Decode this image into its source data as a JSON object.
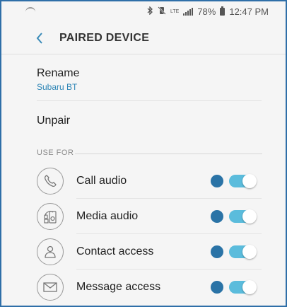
{
  "status_bar": {
    "bluetooth_icon": "bluetooth-icon",
    "mute_icon": "vibrate-mute-icon",
    "network": "LTE",
    "battery_percent": "78%",
    "time": "12:47 PM"
  },
  "header": {
    "back_icon": "chevron-left-icon",
    "title": "PAIRED DEVICE"
  },
  "rename": {
    "label": "Rename",
    "device_name": "Subaru BT"
  },
  "unpair": {
    "label": "Unpair"
  },
  "use_for": {
    "section_title": "USE FOR",
    "items": [
      {
        "label": "Call audio",
        "icon": "phone-icon",
        "enabled": true
      },
      {
        "label": "Media audio",
        "icon": "media-icon",
        "enabled": true
      },
      {
        "label": "Contact access",
        "icon": "person-icon",
        "enabled": true
      },
      {
        "label": "Message access",
        "icon": "envelope-icon",
        "enabled": true
      }
    ]
  },
  "colors": {
    "accent": "#2f86b6",
    "toggle_on": "#5bbcdc",
    "dot": "#2a73a6",
    "frame_border": "#2f6fa8"
  }
}
